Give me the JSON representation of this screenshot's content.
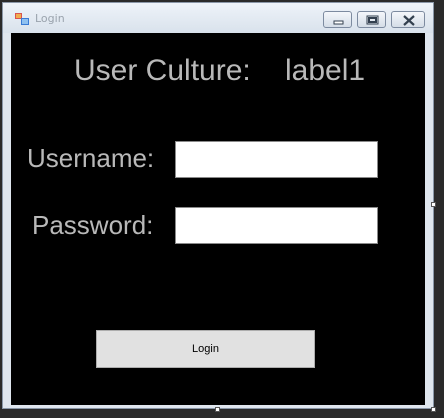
{
  "window": {
    "title": "Login",
    "icons": {
      "app": "app-icon",
      "minimize": "minimize-icon",
      "maximize": "maximize-icon",
      "close": "close-icon"
    }
  },
  "form": {
    "culture_caption": "User Culture:",
    "culture_value": "label1",
    "username_label": "Username:",
    "username_value": "",
    "password_label": "Password:",
    "password_value": "",
    "login_button": "Login"
  },
  "colors": {
    "client_background": "#000000",
    "label_text": "#b9b9b9",
    "button_face": "#e1e1e1"
  }
}
